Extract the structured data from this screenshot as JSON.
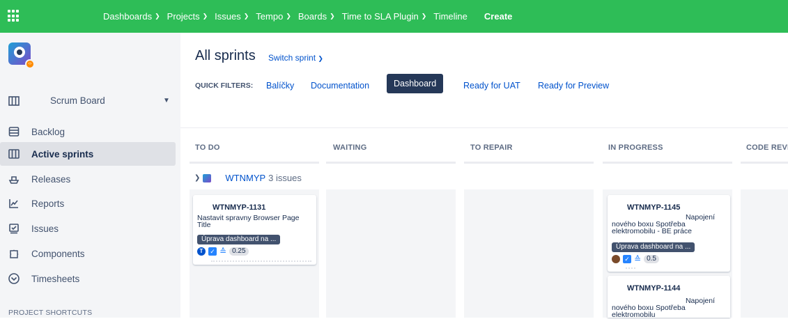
{
  "topbar": {
    "nav": [
      {
        "label": "Dashboards",
        "chevron": true
      },
      {
        "label": "Projects",
        "chevron": true
      },
      {
        "label": "Issues",
        "chevron": true
      },
      {
        "label": "Tempo",
        "chevron": true
      },
      {
        "label": "Boards",
        "chevron": true
      },
      {
        "label": "Time to SLA Plugin",
        "chevron": true
      },
      {
        "label": "Timeline",
        "chevron": false
      }
    ],
    "create_label": "Create",
    "color": "#2ebd57"
  },
  "sidebar": {
    "board_switcher": "Scrum Board",
    "items": [
      {
        "label": "Backlog",
        "icon": "backlog-icon"
      },
      {
        "label": "Active sprints",
        "icon": "board-icon",
        "active": true
      },
      {
        "label": "Releases",
        "icon": "ship-icon"
      },
      {
        "label": "Reports",
        "icon": "chart-icon"
      },
      {
        "label": "Issues",
        "icon": "issues-icon"
      },
      {
        "label": "Components",
        "icon": "puzzle-icon"
      },
      {
        "label": "Timesheets",
        "icon": "clock-icon"
      }
    ],
    "shortcuts_heading": "PROJECT SHORTCUTS"
  },
  "main": {
    "title": "All sprints",
    "switch_sprint": "Switch sprint",
    "quick_filters_label": "QUICK FILTERS:",
    "quick_filters": [
      {
        "label": "Balíčky"
      },
      {
        "label": "Documentation"
      },
      {
        "label": "Dashboard",
        "selected": true
      },
      {
        "label": "Ready for UAT"
      },
      {
        "label": "Ready for Preview"
      }
    ],
    "columns": [
      "TO DO",
      "WAITING",
      "TO REPAIR",
      "IN PROGRESS",
      "CODE REVIE"
    ],
    "swimlane": {
      "key": "WTNMYP",
      "count": "3 issues"
    },
    "cards": [
      {
        "key": "WTNMYP-1131",
        "summary": [
          "Nastavit spravny Browser Page",
          "Title"
        ],
        "epic": "Úprava dashboard na ...",
        "assignee": "T",
        "estimate": "0.25"
      },
      {
        "key": "WTNMYP-1145",
        "summary": [
          "Napojení",
          "nového boxu Spotřeba",
          "elektromobilu - BE práce"
        ],
        "epic": "Úprava dashboard na ...",
        "estimate": "0.5"
      },
      {
        "key": "WTNMYP-1144",
        "summary": [
          "Napojení",
          "nového boxu Spotřeba",
          "elektromobilu"
        ]
      }
    ]
  }
}
